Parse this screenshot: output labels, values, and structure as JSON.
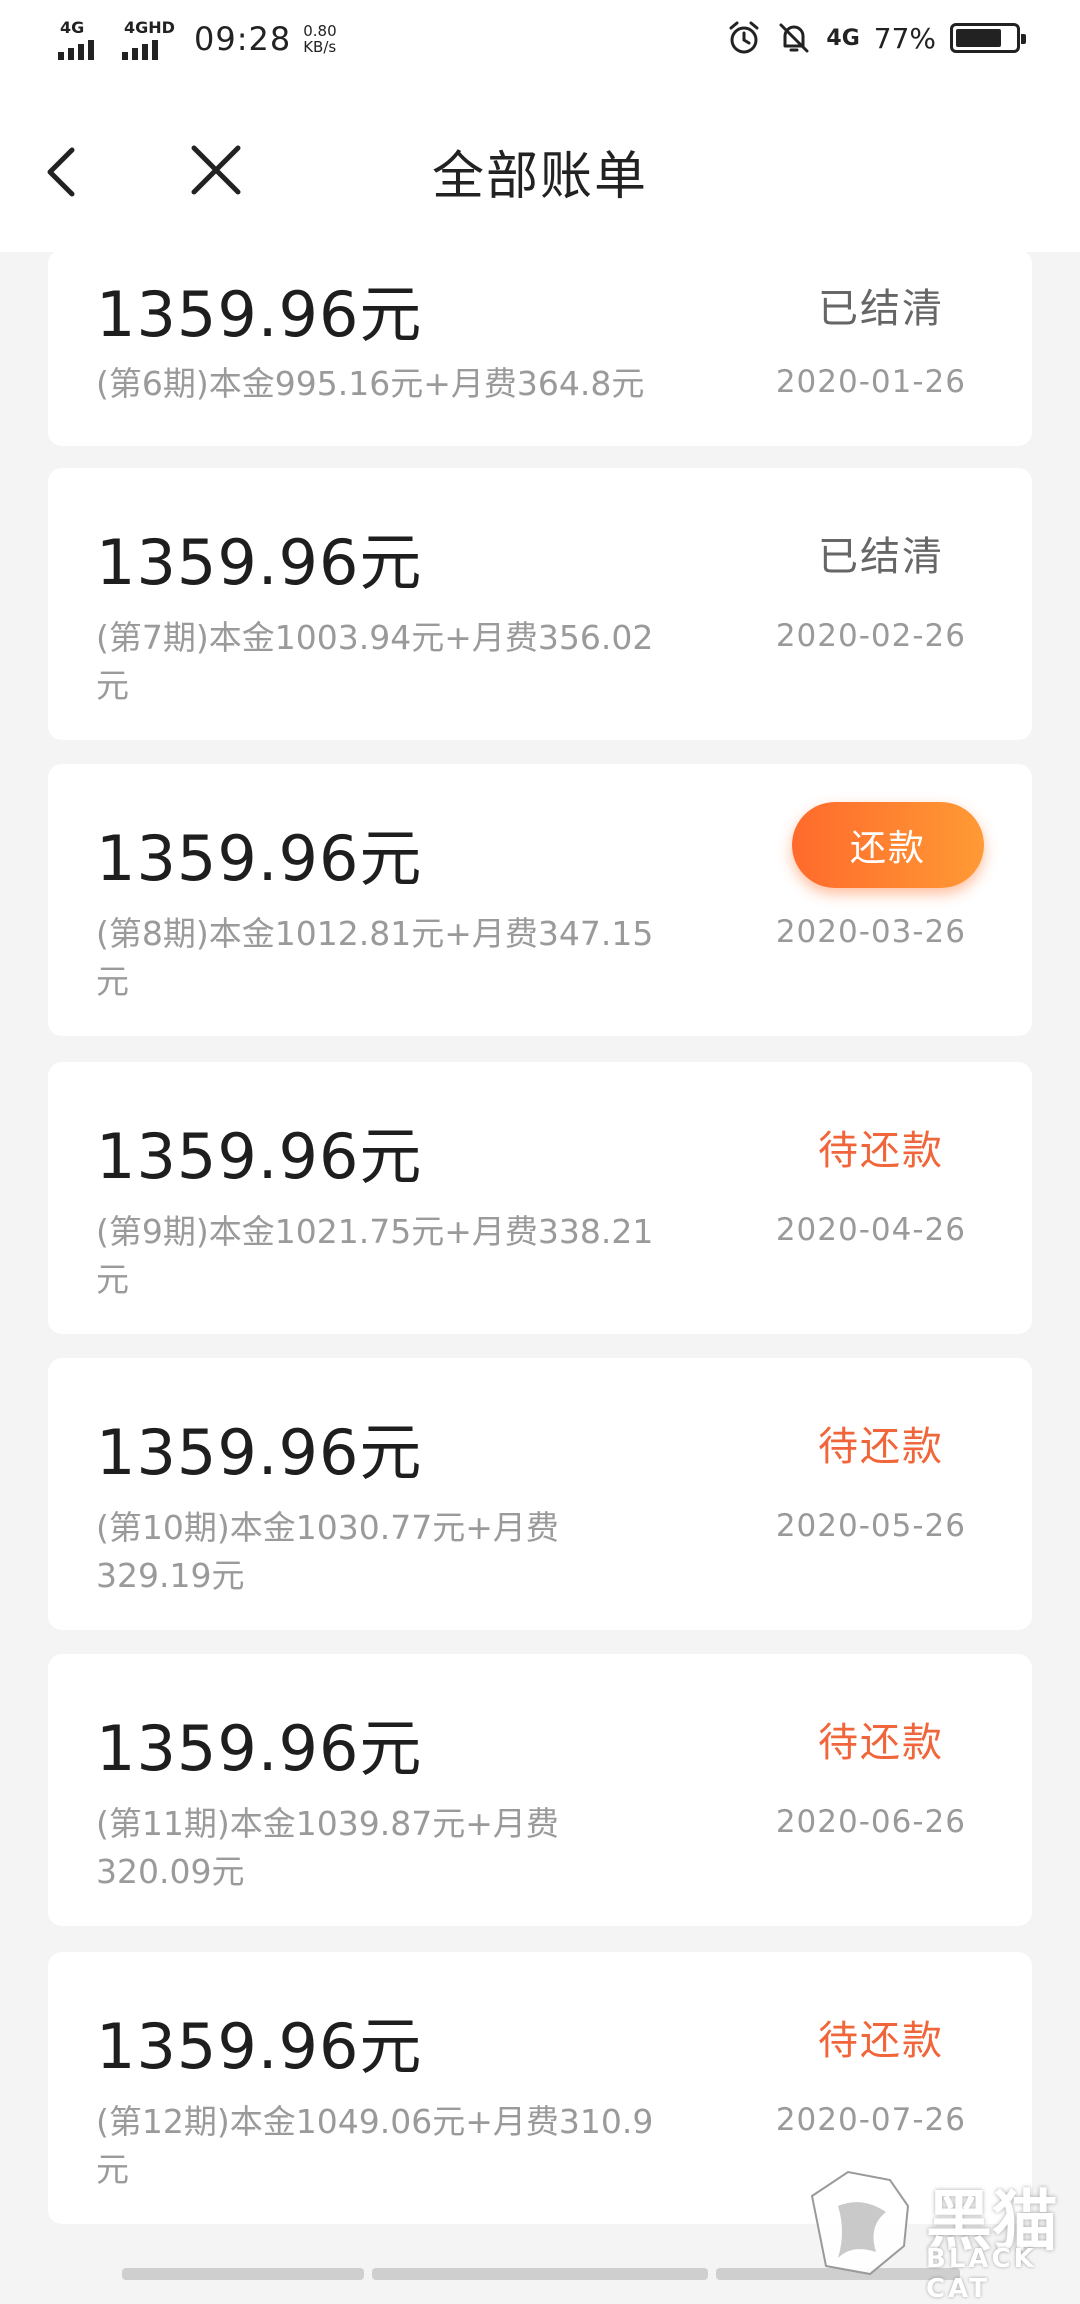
{
  "status_bar": {
    "network_1": "4G",
    "network_2": "4GHD",
    "time": "09:28",
    "speed_value": "0.80",
    "speed_unit": "KB/s",
    "network_3": "4G",
    "battery_pct": "77%",
    "battery_level": 0.77
  },
  "nav": {
    "title": "全部账单"
  },
  "bills": [
    {
      "amount": "1359.96元",
      "desc": "(第6期)本金995.16元+月费364.8元",
      "status": "已结清",
      "status_kind": "settled",
      "date": "2020-01-26"
    },
    {
      "amount": "1359.96元",
      "desc": "(第7期)本金1003.94元+月费356.02元",
      "status": "已结清",
      "status_kind": "settled",
      "date": "2020-02-26"
    },
    {
      "amount": "1359.96元",
      "desc": "(第8期)本金1012.81元+月费347.15元",
      "status": "还款",
      "status_kind": "button",
      "date": "2020-03-26"
    },
    {
      "amount": "1359.96元",
      "desc": "(第9期)本金1021.75元+月费338.21元",
      "status": "待还款",
      "status_kind": "pending",
      "date": "2020-04-26"
    },
    {
      "amount": "1359.96元",
      "desc": "(第10期)本金1030.77元+月费329.19元",
      "status": "待还款",
      "status_kind": "pending",
      "date": "2020-05-26"
    },
    {
      "amount": "1359.96元",
      "desc": "(第11期)本金1039.87元+月费320.09元",
      "status": "待还款",
      "status_kind": "pending",
      "date": "2020-06-26"
    },
    {
      "amount": "1359.96元",
      "desc": "(第12期)本金1049.06元+月费310.9元",
      "status": "待还款",
      "status_kind": "pending",
      "date": "2020-07-26"
    }
  ],
  "watermark": {
    "text": "黑猫",
    "sub": "BLACK CAT"
  },
  "colors": {
    "accent": "#ff7a30",
    "pending": "#f0663a",
    "settled": "#666666"
  }
}
